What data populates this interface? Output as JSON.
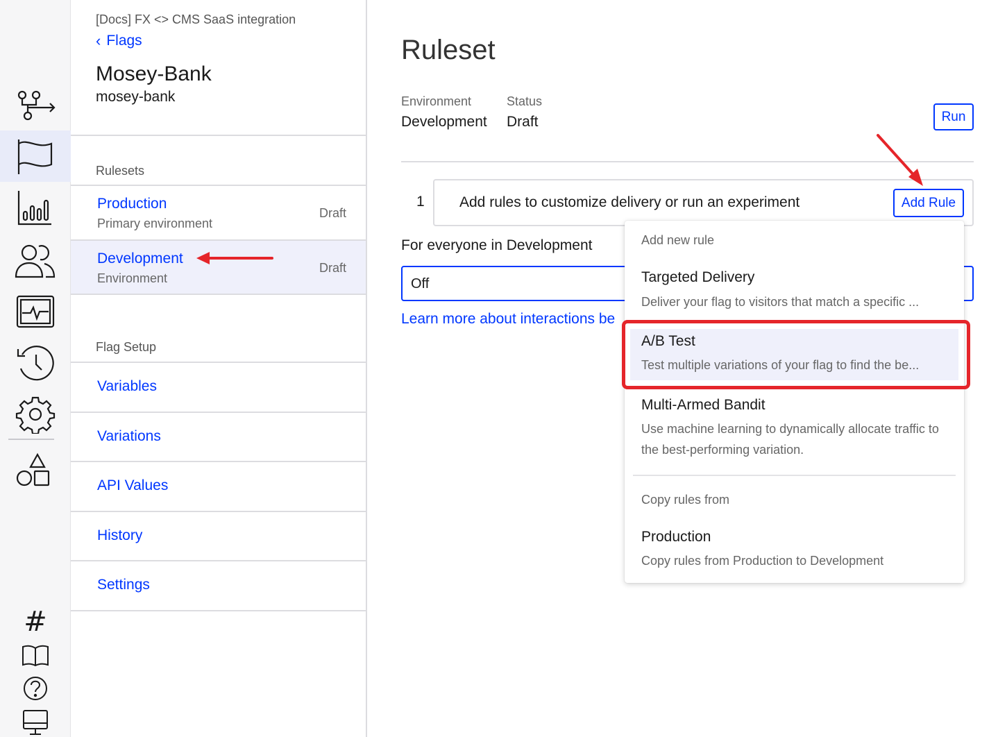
{
  "nav": {
    "project": "[Docs] FX <> CMS SaaS integration",
    "back_label": "Flags",
    "flag_name": "Mosey-Bank",
    "flag_key": "mosey-bank",
    "rulesets_label": "Rulesets",
    "rulesets": [
      {
        "name": "Production",
        "sub": "Primary environment",
        "status": "Draft"
      },
      {
        "name": "Development",
        "sub": "Environment",
        "status": "Draft"
      }
    ],
    "flag_setup_label": "Flag Setup",
    "setup_items": [
      "Variables",
      "Variations",
      "API Values",
      "History",
      "Settings"
    ]
  },
  "main": {
    "title": "Ruleset",
    "environment_label": "Environment",
    "environment_value": "Development",
    "status_label": "Status",
    "status_value": "Draft",
    "run_label": "Run",
    "rule_number": "1",
    "rule_message": "Add rules to customize delivery or run an experiment",
    "add_rule_label": "Add Rule",
    "everyone_label": "For everyone in Development",
    "select_value": "Off",
    "learn_more": "Learn more about interactions be"
  },
  "dropdown": {
    "add_new_label": "Add new rule",
    "items": [
      {
        "title": "Targeted Delivery",
        "desc": "Deliver your flag to visitors that match a specific ..."
      },
      {
        "title": "A/B Test",
        "desc": "Test multiple variations of your flag to find the be..."
      },
      {
        "title": "Multi-Armed Bandit",
        "desc": "Use machine learning to dynamically allocate traffic to the best-performing variation."
      }
    ],
    "copy_label": "Copy rules from",
    "copy_item": {
      "title": "Production",
      "desc": "Copy rules from Production to Development"
    }
  },
  "rail": {
    "icons": [
      "workflow-icon",
      "flag-icon",
      "chart-icon",
      "users-icon",
      "monitor-icon",
      "history-icon",
      "gear-icon",
      "shapes-icon"
    ],
    "bottom_hash": "#"
  },
  "colors": {
    "accent": "#0037ff",
    "annotation": "#e5252a",
    "active_bg": "#eff0fb"
  }
}
